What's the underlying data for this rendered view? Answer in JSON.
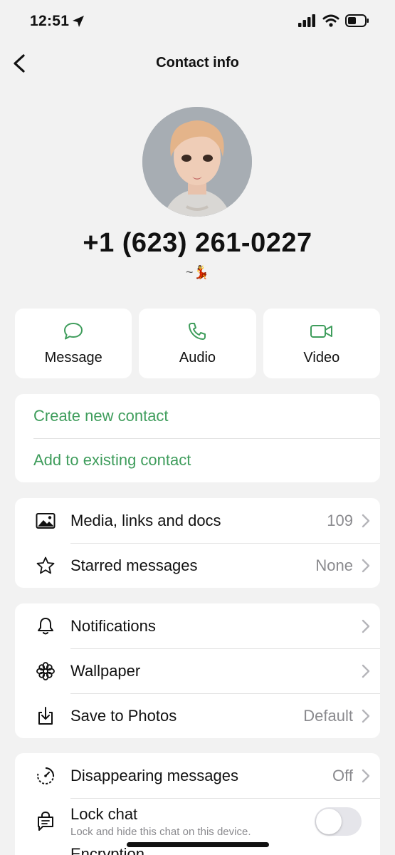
{
  "status_bar": {
    "time": "12:51"
  },
  "nav": {
    "title": "Contact info"
  },
  "contact": {
    "phone": "+1 (623) 261-0227",
    "about": "~💃"
  },
  "actions": [
    {
      "label": "Message",
      "icon": "message-icon"
    },
    {
      "label": "Audio",
      "icon": "phone-icon"
    },
    {
      "label": "Video",
      "icon": "video-icon"
    }
  ],
  "contact_options": {
    "create": "Create new contact",
    "add_existing": "Add to existing contact"
  },
  "media_section": {
    "media_label": "Media, links and docs",
    "media_count": "109",
    "starred_label": "Starred messages",
    "starred_value": "None"
  },
  "settings_section": {
    "notifications_label": "Notifications",
    "wallpaper_label": "Wallpaper",
    "save_label": "Save to Photos",
    "save_value": "Default"
  },
  "privacy_section": {
    "disappearing_label": "Disappearing messages",
    "disappearing_value": "Off",
    "lock_label": "Lock chat",
    "lock_sub": "Lock and hide this chat on this device.",
    "lock_enabled": false,
    "encryption_label": "Encryption"
  },
  "colors": {
    "accent": "#3f9d5c",
    "background": "#f2f2f2",
    "secondary_text": "#8a8a8e"
  }
}
